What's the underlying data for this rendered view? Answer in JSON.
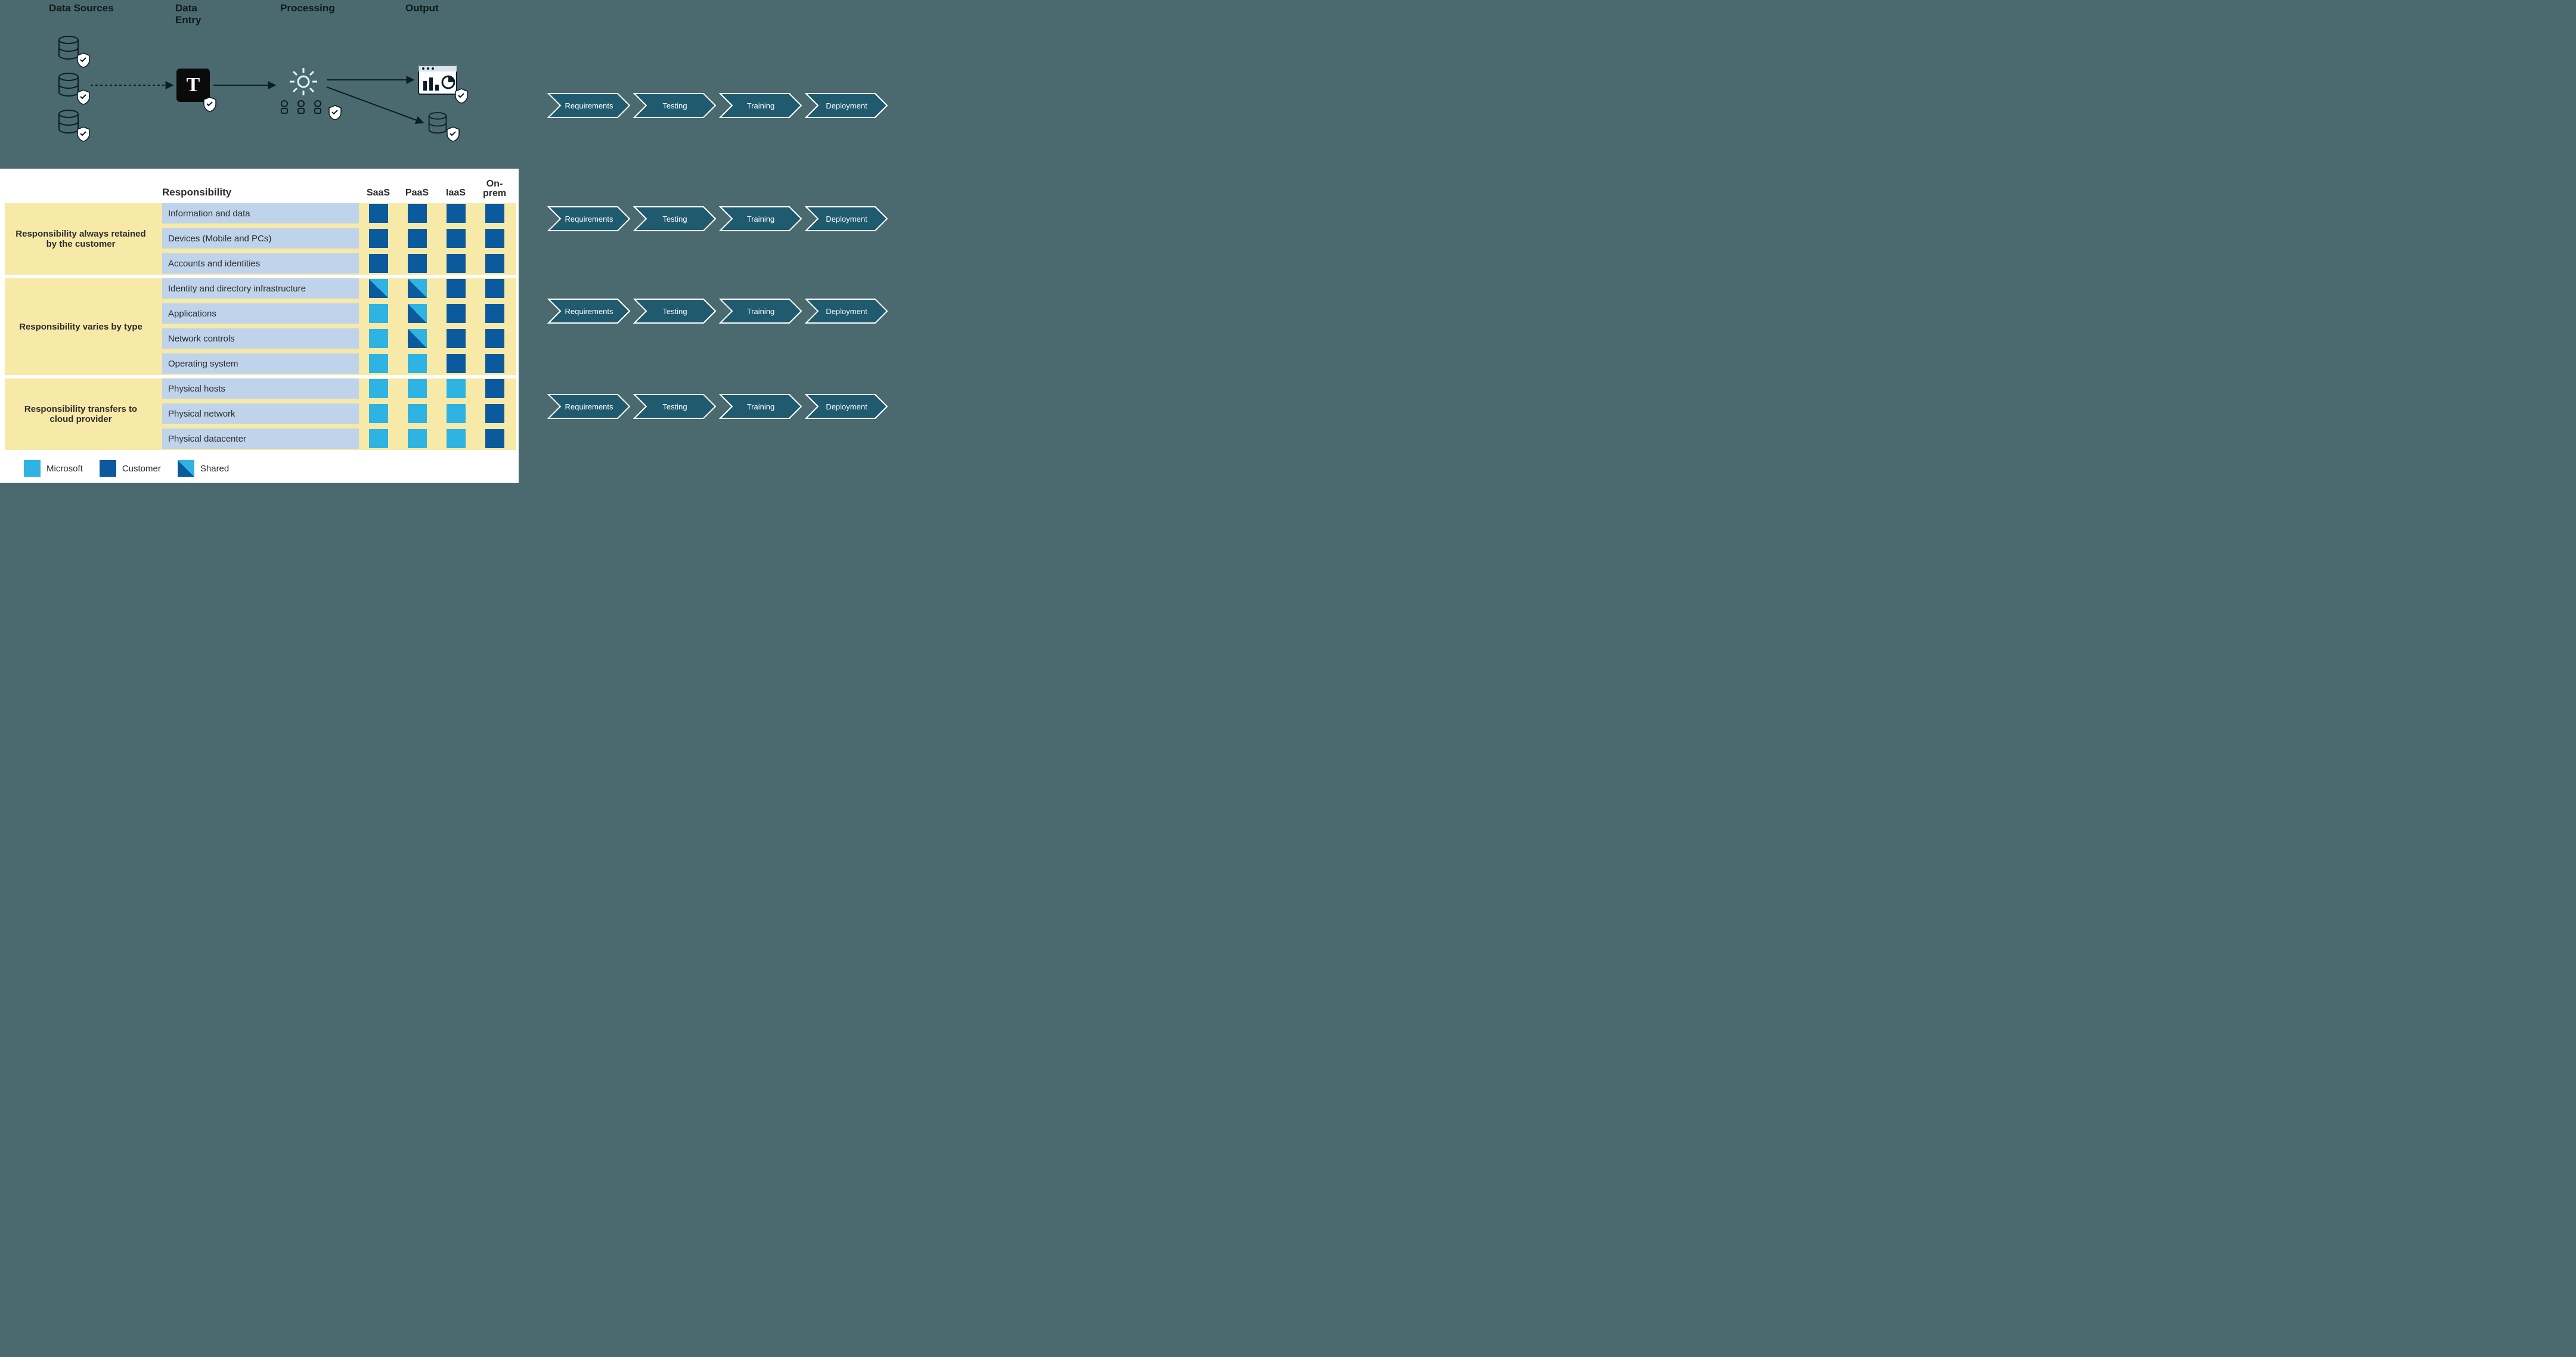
{
  "flow": {
    "labels": {
      "sources": "Data Sources",
      "entry": "Data Entry",
      "processing": "Processing",
      "output": "Output"
    }
  },
  "chevrons": {
    "steps": [
      "Requirements",
      "Testing",
      "Training",
      "Deployment"
    ],
    "row_count": 4
  },
  "matrix": {
    "header": {
      "responsibility": "Responsibility",
      "cols": [
        "SaaS",
        "PaaS",
        "IaaS",
        "On-\nprem"
      ]
    },
    "bands": [
      {
        "label": "Responsibility always retained by the customer",
        "row_start": 0,
        "row_end": 2
      },
      {
        "label": "Responsibility varies by type",
        "row_start": 3,
        "row_end": 6
      },
      {
        "label": "Responsibility transfers to cloud provider",
        "row_start": 7,
        "row_end": 9
      }
    ],
    "rows": [
      {
        "label": "Information and data",
        "cells": [
          "customer",
          "customer",
          "customer",
          "customer"
        ]
      },
      {
        "label": "Devices (Mobile and PCs)",
        "cells": [
          "customer",
          "customer",
          "customer",
          "customer"
        ]
      },
      {
        "label": "Accounts and identities",
        "cells": [
          "customer",
          "customer",
          "customer",
          "customer"
        ]
      },
      {
        "label": "Identity and directory infrastructure",
        "cells": [
          "shared",
          "shared",
          "customer",
          "customer"
        ]
      },
      {
        "label": "Applications",
        "cells": [
          "microsoft",
          "shared",
          "customer",
          "customer"
        ]
      },
      {
        "label": "Network controls",
        "cells": [
          "microsoft",
          "shared",
          "customer",
          "customer"
        ]
      },
      {
        "label": "Operating system",
        "cells": [
          "microsoft",
          "microsoft",
          "customer",
          "customer"
        ]
      },
      {
        "label": "Physical hosts",
        "cells": [
          "microsoft",
          "microsoft",
          "microsoft",
          "customer"
        ]
      },
      {
        "label": "Physical network",
        "cells": [
          "microsoft",
          "microsoft",
          "microsoft",
          "customer"
        ]
      },
      {
        "label": "Physical datacenter",
        "cells": [
          "microsoft",
          "microsoft",
          "microsoft",
          "customer"
        ]
      }
    ],
    "legend": {
      "microsoft": "Microsoft",
      "customer": "Customer",
      "shared": "Shared"
    }
  },
  "colors": {
    "band": "#f7e9a8",
    "row_label_bg": "#bfd3ea",
    "customer": "#0c5a9e",
    "microsoft": "#2fb3e3",
    "chevron_fill": "#1f5a6e",
    "chevron_stroke": "#ffffff",
    "page_bg": "#4b6a6f"
  }
}
